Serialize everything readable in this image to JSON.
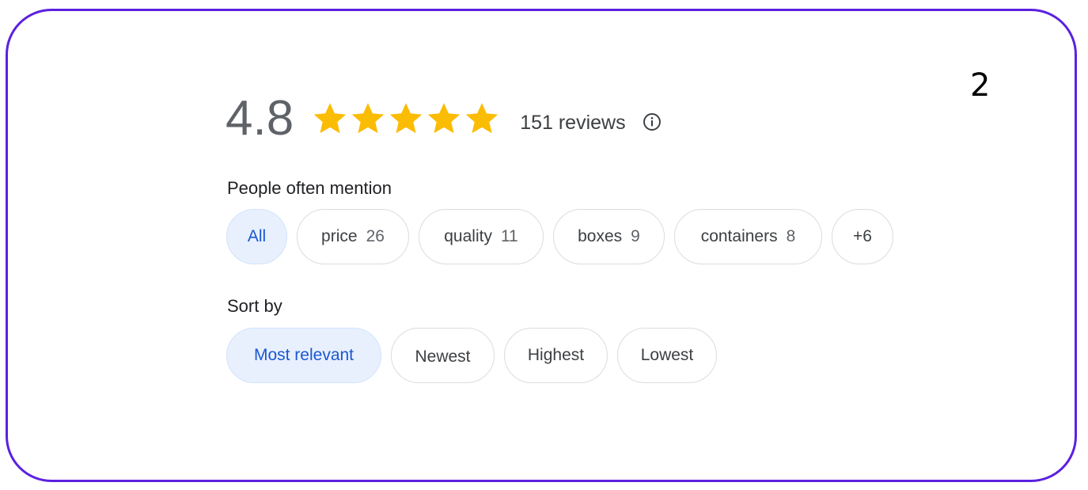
{
  "page_number": "2",
  "rating": {
    "value": "4.8",
    "stars": 5,
    "star_color": "#fbbc04",
    "reviews_label": "151 reviews",
    "info_icon": "info-icon"
  },
  "mentions": {
    "label": "People often mention",
    "chips": [
      {
        "label": "All",
        "count": "",
        "selected": true
      },
      {
        "label": "price",
        "count": "26",
        "selected": false
      },
      {
        "label": "quality",
        "count": "11",
        "selected": false
      },
      {
        "label": "boxes",
        "count": "9",
        "selected": false
      },
      {
        "label": "containers",
        "count": "8",
        "selected": false
      },
      {
        "label": "+6",
        "count": "",
        "selected": false
      }
    ]
  },
  "sort": {
    "label": "Sort by",
    "options": [
      {
        "label": "Most relevant",
        "selected": true
      },
      {
        "label": "Newest",
        "selected": false
      },
      {
        "label": "Highest",
        "selected": false
      },
      {
        "label": "Lowest",
        "selected": false
      }
    ]
  },
  "colors": {
    "frame_border": "#5b21e0",
    "selected_chip_bg": "#e8f0fe",
    "selected_chip_text": "#1a58d0"
  }
}
